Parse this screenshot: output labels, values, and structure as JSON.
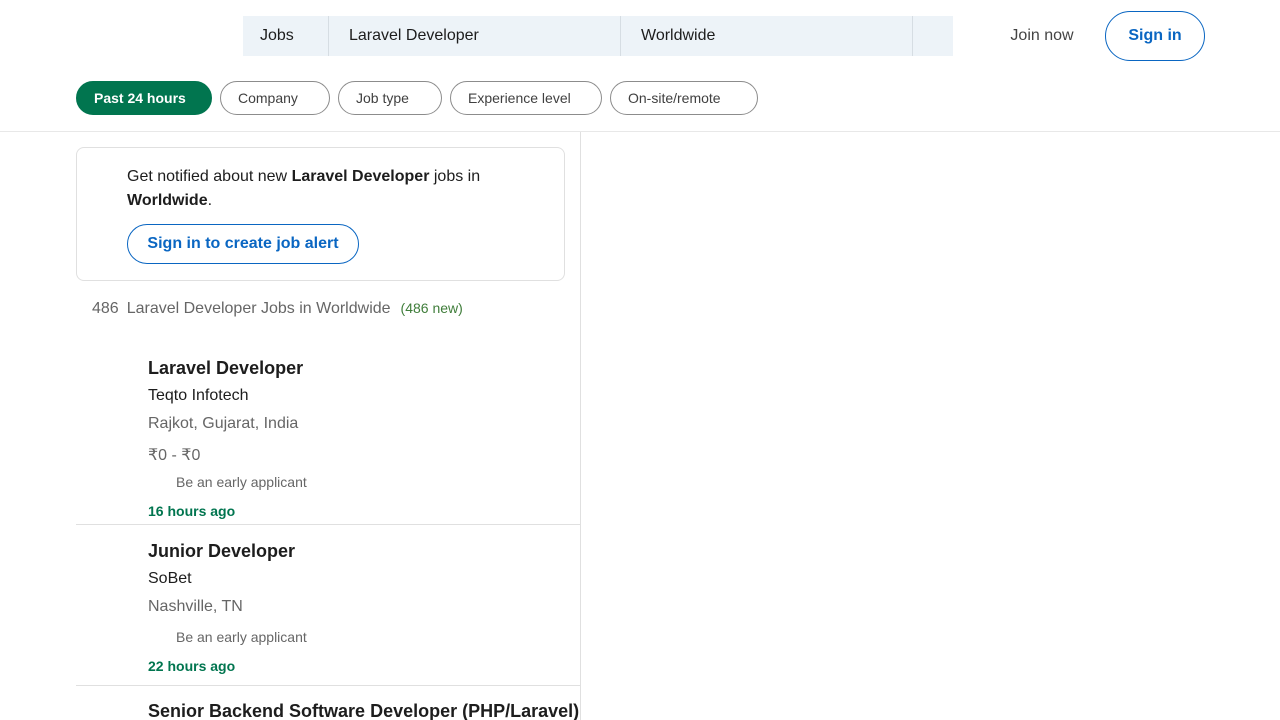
{
  "header": {
    "search": {
      "jobs_label": "Jobs",
      "keyword": "Laravel Developer",
      "location": "Worldwide"
    },
    "join_now": "Join now",
    "sign_in": "Sign in"
  },
  "filters": [
    {
      "label": "Past 24 hours",
      "active": true
    },
    {
      "label": "Company"
    },
    {
      "label": "Job type"
    },
    {
      "label": "Experience level"
    },
    {
      "label": "On-site/remote"
    }
  ],
  "alert": {
    "prefix": "Get notified about new ",
    "keyword": "Laravel Developer",
    "middle": " jobs in ",
    "location": "Worldwide",
    "suffix": ".",
    "button": "Sign in to create job alert"
  },
  "results": {
    "count": "486",
    "label": "Laravel Developer Jobs in Worldwide",
    "new": "(486 new)"
  },
  "jobs": [
    {
      "title": "Laravel Developer",
      "company": "Teqto Infotech",
      "location": "Rajkot, Gujarat, India",
      "salary": "₹0 - ₹0",
      "applicant": "Be an early applicant",
      "posted": "16 hours ago"
    },
    {
      "title": "Junior Developer",
      "company": "SoBet",
      "location": "Nashville, TN",
      "applicant": "Be an early applicant",
      "posted": "22 hours ago"
    },
    {
      "title": "Senior Backend Software Developer (PHP/Laravel)"
    }
  ],
  "colors": {
    "brand_blue": "#0a66c2",
    "active_green": "#01754f",
    "search_bg": "#edf3f8"
  }
}
